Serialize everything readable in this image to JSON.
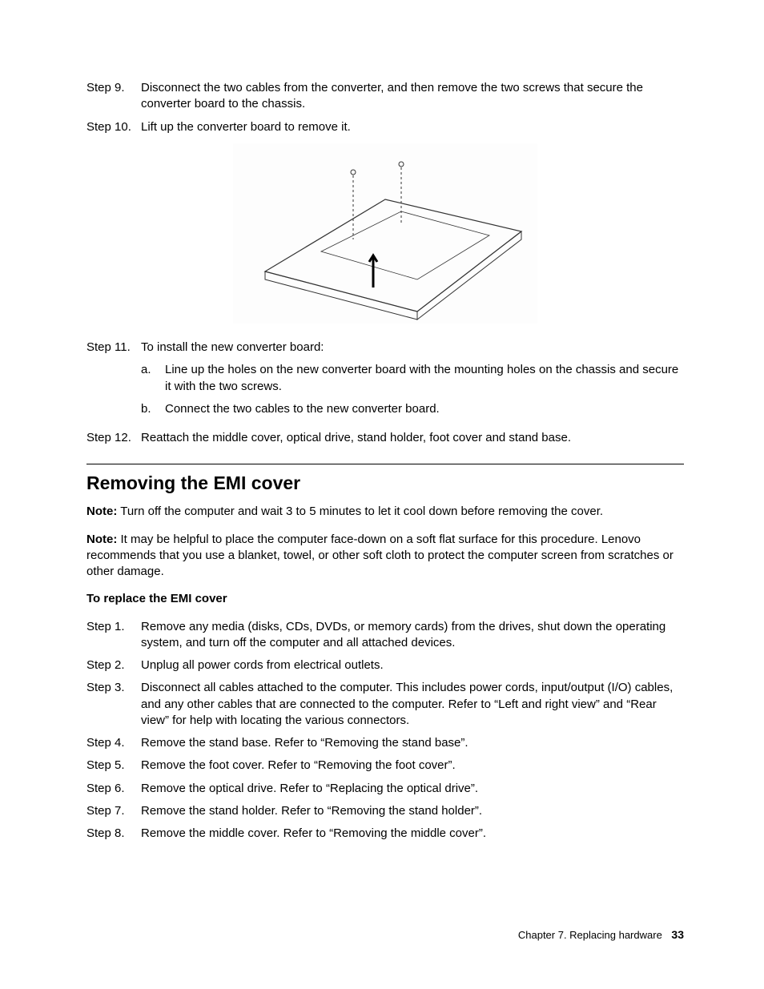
{
  "stepsA": [
    {
      "label": "Step 9.",
      "text": "Disconnect the two cables from the converter, and then remove the two screws that secure the converter board to the chassis."
    },
    {
      "label": "Step 10.",
      "text": "Lift up the converter board to remove it."
    }
  ],
  "figure_alt": "Illustration of computer chassis showing converter board removal with two screws and an upward arrow.",
  "step11": {
    "label": "Step 11.",
    "text": "To install the new converter board:",
    "subs": [
      {
        "label": "a.",
        "text": "Line up the holes on the new converter board with the mounting holes on the chassis and secure it with the two screws."
      },
      {
        "label": "b.",
        "text": "Connect the two cables to the new converter board."
      }
    ]
  },
  "step12": {
    "label": "Step 12.",
    "text": "Reattach the middle cover, optical drive, stand holder, foot cover and stand base."
  },
  "heading": "Removing the EMI cover",
  "note_label": "Note:",
  "note1": " Turn off the computer and wait 3 to 5 minutes to let it cool down before removing the cover.",
  "note2": " It may be helpful to place the computer face-down on a soft flat surface for this procedure. Lenovo recommends that you use a blanket, towel, or other soft cloth to protect the computer screen from scratches or other damage.",
  "subheading": "To replace the EMI cover",
  "stepsB": [
    {
      "label": "Step 1.",
      "text": "Remove any media (disks, CDs, DVDs, or memory cards) from the drives, shut down the operating system, and turn off the computer and all attached devices."
    },
    {
      "label": "Step 2.",
      "text": "Unplug all power cords from electrical outlets."
    },
    {
      "label": "Step 3.",
      "text": "Disconnect all cables attached to the computer. This includes power cords, input/output (I/O) cables, and any other cables that are connected to the computer. Refer to “Left and right view” and “Rear view” for help with locating the various connectors."
    },
    {
      "label": "Step 4.",
      "text": "Remove the stand base. Refer to “Removing the stand base”."
    },
    {
      "label": "Step 5.",
      "text": "Remove the foot cover. Refer to “Removing the foot cover”."
    },
    {
      "label": "Step 6.",
      "text": "Remove the optical drive. Refer to “Replacing the optical drive”."
    },
    {
      "label": "Step 7.",
      "text": "Remove the stand holder. Refer to “Removing the stand holder”."
    },
    {
      "label": "Step 8.",
      "text": "Remove the middle cover. Refer to “Removing the middle cover”."
    }
  ],
  "footer": {
    "chapter": "Chapter 7. Replacing hardware",
    "page": "33"
  }
}
